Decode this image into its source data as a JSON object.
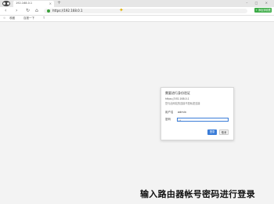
{
  "browser": {
    "tab_title": "192.168.0.1",
    "tab_close": "×",
    "new_tab": "+",
    "window_controls": "– □ ×",
    "nav": {
      "back": "‹",
      "forward": "›",
      "reload": "↻",
      "home": "⌂"
    },
    "url": "https://192.168.0.1",
    "extension_label": "+ 添加到收藏"
  },
  "bookmarks": {
    "star": "☆",
    "items": [
      {
        "label": "收藏"
      },
      {
        "label": "百度一下"
      },
      {
        "label": "T"
      }
    ]
  },
  "dialog": {
    "title": "需要进行身份验证",
    "url": "https://192.168.0.1",
    "note": "您与此网站的连接不是私密连接",
    "username_label": "用户名",
    "username_value": "admin",
    "password_label": "密码",
    "password_value": "••",
    "login_button": "登录",
    "cancel_button": "取消"
  },
  "caption": "输入路由器帐号密码进行登录"
}
